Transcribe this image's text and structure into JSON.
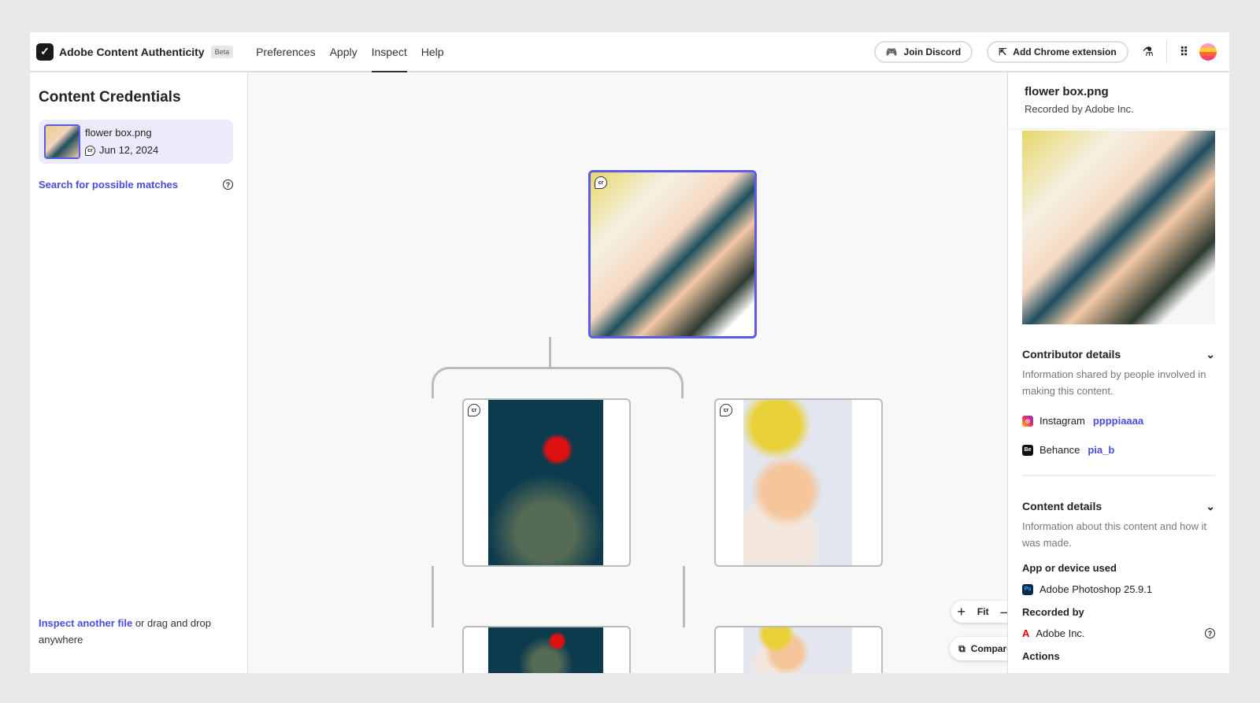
{
  "header": {
    "brand": "Adobe Content Authenticity",
    "beta": "Beta",
    "nav": [
      "Preferences",
      "Apply",
      "Inspect",
      "Help"
    ],
    "active_tab": "Inspect",
    "join_discord": "Join Discord",
    "add_chrome": "Add Chrome extension"
  },
  "left": {
    "title": "Content Credentials",
    "file": {
      "name": "flower box.png",
      "date": "Jun 12, 2024"
    },
    "search_link": "Search for possible matches",
    "inspect_link": "Inspect another file",
    "inspect_rest": " or drag and drop anywhere"
  },
  "canvas": {
    "cr_label": "cr",
    "fit": "Fit",
    "compare": "Compare"
  },
  "right": {
    "name": "flower box.png",
    "recorded": "Recorded by Adobe Inc.",
    "contributor": {
      "title": "Contributor details",
      "desc": "Information shared by people involved in making this content.",
      "accounts": [
        {
          "platform": "Instagram",
          "handle": "ppppiaaaa"
        },
        {
          "platform": "Behance",
          "handle": "pia_b"
        }
      ]
    },
    "content": {
      "title": "Content details",
      "desc": "Information about this content and how it was made.",
      "app_label": "App or device used",
      "app": "Adobe Photoshop 25.9.1",
      "recorded_label": "Recorded by",
      "recorded_by": "Adobe Inc.",
      "actions": "Actions"
    }
  },
  "colors": {
    "accent": "#4b4bde"
  }
}
